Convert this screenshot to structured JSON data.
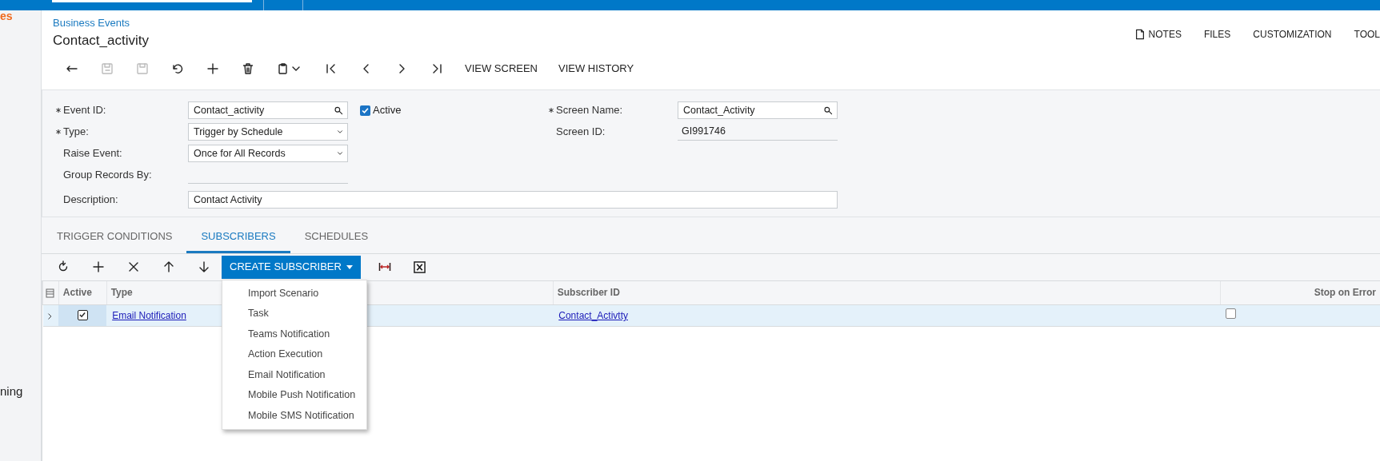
{
  "sidebar": {
    "items": [
      {
        "label": "es",
        "kind": "brand"
      },
      {
        "label": "ning",
        "kind": "item"
      }
    ]
  },
  "breadcrumb": "Business Events",
  "title": "Contact_activity",
  "header_links": [
    {
      "label": "NOTES",
      "kind": "icon"
    },
    {
      "label": "FILES",
      "kind": "plain"
    },
    {
      "label": "CUSTOMIZATION",
      "kind": "plain"
    },
    {
      "label": "TOOL",
      "kind": "plain"
    }
  ],
  "toolbar": {
    "icon_buttons": [
      {
        "disabled": false
      },
      {
        "disabled": true
      },
      {
        "disabled": true
      },
      {
        "disabled": false
      },
      {
        "disabled": false
      },
      {
        "disabled": false
      },
      {
        "disabled": false
      },
      {
        "disabled": false
      },
      {
        "disabled": false
      },
      {
        "disabled": false
      },
      {
        "disabled": false
      }
    ],
    "text_buttons": [
      "VIEW SCREEN",
      "VIEW HISTORY"
    ]
  },
  "form": {
    "left": [
      {
        "label": "Event ID:",
        "required": true,
        "kind": "lookup",
        "value": "Contact_activity"
      },
      {
        "label": "Type:",
        "required": true,
        "kind": "select",
        "value": "Trigger by Schedule"
      },
      {
        "label": "Raise Event:",
        "required": false,
        "kind": "select",
        "value": "Once for All Records"
      },
      {
        "label": "Group Records By:",
        "required": false,
        "kind": "readonly"
      }
    ],
    "active": {
      "label": "Active",
      "checked": true
    },
    "right": [
      {
        "label": "Screen Name:",
        "required": true,
        "kind": "lookup",
        "value": "Contact_Activity"
      },
      {
        "label": "Screen ID:",
        "required": false,
        "kind": "readonly",
        "value": "GI991746"
      }
    ],
    "description": {
      "label": "Description:",
      "value": "Contact Activity"
    }
  },
  "tabs": [
    {
      "label": "TRIGGER CONDITIONS",
      "selected": false
    },
    {
      "label": "SUBSCRIBERS",
      "selected": true
    },
    {
      "label": "SCHEDULES",
      "selected": false
    }
  ],
  "grid_toolbar": {
    "create_button": "CREATE SUBSCRIBER",
    "menu": [
      "Import Scenario",
      "Task",
      "Teams Notification",
      "Action Execution",
      "Email Notification",
      "Mobile Push Notification",
      "Mobile SMS Notification"
    ]
  },
  "table": {
    "columns": [
      "Active",
      "Type",
      "Subscriber ID",
      "Stop on Error"
    ],
    "rows": [
      {
        "selected": true,
        "active": true,
        "type": "Email Notification",
        "subscriber_id": "Contact_Activtty",
        "stop_on_error": false
      }
    ]
  }
}
